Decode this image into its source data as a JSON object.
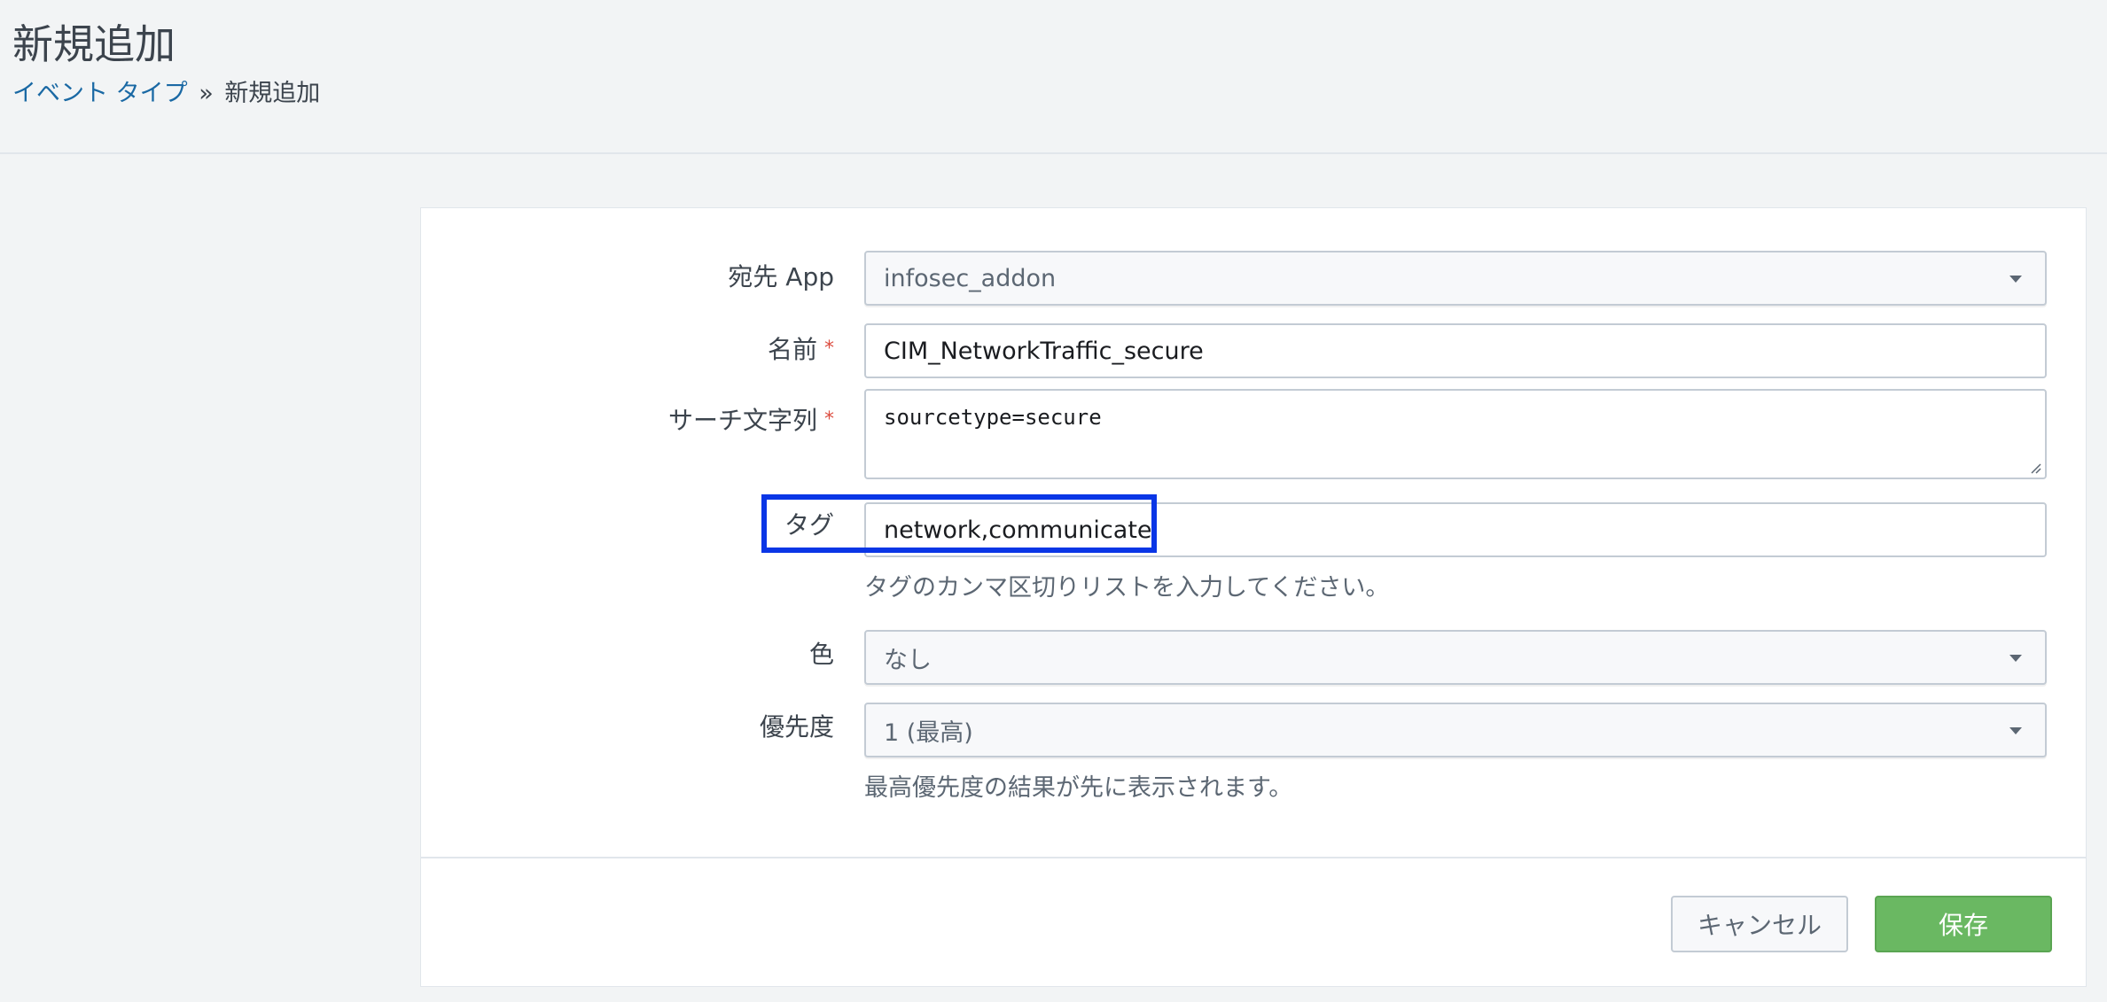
{
  "header": {
    "title": "新規追加",
    "breadcrumb": {
      "parent": "イベント タイプ",
      "separator": "»",
      "current": "新規追加"
    }
  },
  "form": {
    "dest_app": {
      "label": "宛先 App",
      "value": "infosec_addon"
    },
    "name": {
      "label": "名前",
      "required_mark": "*",
      "value": "CIM_NetworkTraffic_secure"
    },
    "search": {
      "label": "サーチ文字列",
      "required_mark": "*",
      "value": "sourcetype=secure"
    },
    "tags": {
      "label": "タグ",
      "value": "network,communicate",
      "help": "タグのカンマ区切りリストを入力してください。"
    },
    "color": {
      "label": "色",
      "value": "なし"
    },
    "priority": {
      "label": "優先度",
      "value": "1 (最高)",
      "help": "最高優先度の結果が先に表示されます。"
    }
  },
  "buttons": {
    "cancel": "キャンセル",
    "save": "保存"
  },
  "colors": {
    "link": "#1a69a4",
    "required": "#dc4e41",
    "save_button": "#6ab862",
    "highlight_box": "#0a36e6"
  }
}
